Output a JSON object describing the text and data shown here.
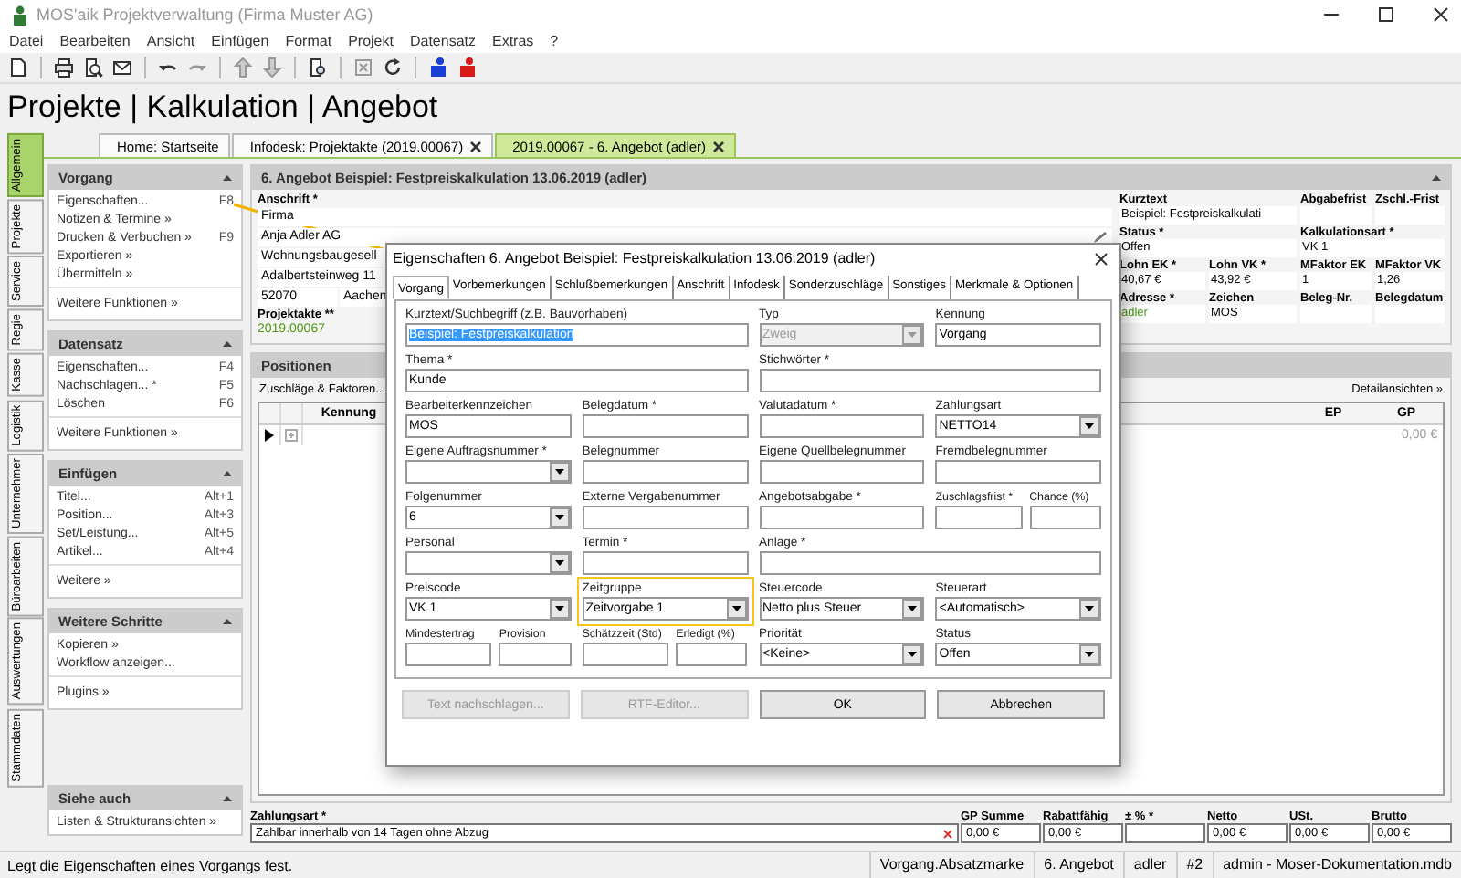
{
  "window": {
    "title": "MOS'aik Projektverwaltung (Firma Muster AG)"
  },
  "menu": [
    "Datei",
    "Bearbeiten",
    "Ansicht",
    "Einfügen",
    "Format",
    "Projekt",
    "Datensatz",
    "Extras",
    "?"
  ],
  "breadcrumb": "Projekte | Kalkulation | Angebot",
  "doc_tabs": [
    {
      "label": "Home: Startseite",
      "closable": false,
      "selected": false
    },
    {
      "label": "Infodesk: Projektakte (2019.00067)",
      "closable": true,
      "selected": false
    },
    {
      "label": "2019.00067 - 6. Angebot (adler)",
      "closable": true,
      "selected": true
    }
  ],
  "side_tabs": [
    {
      "label": "Allgemein",
      "selected": true
    },
    {
      "label": "Projekte",
      "selected": false
    },
    {
      "label": "Service",
      "selected": false
    },
    {
      "label": "Regie",
      "selected": false
    },
    {
      "label": "Kasse",
      "selected": false
    },
    {
      "label": "Logistik",
      "selected": false
    },
    {
      "label": "Unternehmer",
      "selected": false
    },
    {
      "label": "Büroarbeiten",
      "selected": false
    },
    {
      "label": "Auswertungen",
      "selected": false
    },
    {
      "label": "Stammdaten",
      "selected": false
    }
  ],
  "task_panels": [
    {
      "title": "Vorgang",
      "groups": [
        [
          {
            "label": "Eigenschaften...",
            "shortcut": "F8"
          },
          {
            "label": "Notizen & Termine »"
          },
          {
            "label": "Drucken & Verbuchen »",
            "shortcut": "F9"
          },
          {
            "label": "Exportieren »"
          },
          {
            "label": "Übermitteln »"
          }
        ],
        [
          {
            "label": "Weitere Funktionen »"
          }
        ]
      ]
    },
    {
      "title": "Datensatz",
      "groups": [
        [
          {
            "label": "Eigenschaften...",
            "shortcut": "F4"
          },
          {
            "label": "Nachschlagen... *",
            "shortcut": "F5"
          },
          {
            "label": "Löschen",
            "shortcut": "F6"
          }
        ],
        [
          {
            "label": "Weitere Funktionen »"
          }
        ]
      ]
    },
    {
      "title": "Einfügen",
      "groups": [
        [
          {
            "label": "Titel...",
            "shortcut": "Alt+1"
          },
          {
            "label": "Position...",
            "shortcut": "Alt+3"
          },
          {
            "label": "Set/Leistung...",
            "shortcut": "Alt+5"
          },
          {
            "label": "Artikel...",
            "shortcut": "Alt+4"
          }
        ],
        [
          {
            "label": "Weitere »"
          }
        ]
      ]
    },
    {
      "title": "Weitere Schritte",
      "groups": [
        [
          {
            "label": "Kopieren »"
          },
          {
            "label": "Workflow anzeigen..."
          }
        ],
        [
          {
            "label": "Plugins »"
          }
        ]
      ]
    },
    {
      "title": "Siehe auch",
      "groups": [
        [
          {
            "label": "Listen & Strukturansichten »"
          }
        ]
      ]
    }
  ],
  "document": {
    "title": "6. Angebot Beispiel: Festpreiskalkulation 13.06.2019 (adler)",
    "address": {
      "label": "Anschrift *",
      "lines": [
        "Firma",
        "Anja Adler AG",
        "Wohnungsbaugesell",
        "Adalbertsteinweg 11"
      ],
      "zip": "52070",
      "city": "Aachen"
    },
    "project": {
      "label": "Projektakte **",
      "value": "2019.00067"
    },
    "summary": [
      {
        "label": "Kurztext",
        "value": "Beispiel: Festpreiskalkulati",
        "kind": "wide"
      },
      {
        "label": "Abgabefrist",
        "kind": "narrow"
      },
      {
        "label": "Zschl.-Frist",
        "kind": "narrow"
      },
      {
        "label": "Status *",
        "value": "Offen",
        "kind": "wide"
      },
      {
        "label": "Kalkulationsart *",
        "value": "VK 1",
        "kind": "wide"
      },
      {
        "label": "Lohn EK *",
        "value": "40,67 €",
        "kind": "narrow"
      },
      {
        "label": "Lohn VK *",
        "value": "43,92 €",
        "kind": "narrow"
      },
      {
        "label": "MFaktor EK",
        "value": "1",
        "kind": "narrow"
      },
      {
        "label": "MFaktor VK",
        "value": "1,26",
        "kind": "narrow"
      },
      {
        "label": "Adresse *",
        "value": "adler",
        "kind": "narrow",
        "link": true
      },
      {
        "label": "Zeichen",
        "value": "MOS",
        "kind": "narrow"
      },
      {
        "label": "Beleg-Nr.",
        "kind": "narrow"
      },
      {
        "label": "Belegdatum",
        "kind": "narrow"
      }
    ]
  },
  "positions": {
    "title": "Positionen",
    "link": "Zuschläge & Faktoren...",
    "details_link": "Detailansichten »",
    "columns": [
      "Kennung",
      "EP",
      "GP"
    ],
    "rows": [
      {
        "gp": "0,00 €"
      }
    ]
  },
  "footer": {
    "payment_label": "Zahlungsart *",
    "payment": "Zahlbar innerhalb von 14 Tagen ohne Abzug",
    "totals": [
      {
        "label": "GP Summe",
        "value": "0,00 €"
      },
      {
        "label": "Rabattfähig",
        "value": "0,00 €"
      },
      {
        "label": "± % *"
      },
      {
        "label": "Netto",
        "value": "0,00 €"
      },
      {
        "label": "USt.",
        "value": "0,00 €"
      },
      {
        "label": "Brutto",
        "value": "0,00 €"
      }
    ]
  },
  "dialog": {
    "title": "Eigenschaften 6. Angebot Beispiel: Festpreiskalkulation 13.06.2019 (adler)",
    "tabs": [
      {
        "label": "Vorgang",
        "selected": true
      },
      {
        "label": "Vorbemerkungen",
        "selected": false
      },
      {
        "label": "Schlußbemerkungen",
        "selected": false
      },
      {
        "label": "Anschrift",
        "selected": false
      },
      {
        "label": "Infodesk",
        "selected": false
      },
      {
        "label": "Sonderzuschläge",
        "selected": false
      },
      {
        "label": "Sonstiges",
        "selected": false
      },
      {
        "label": "Merkmale & Optionen",
        "selected": false
      }
    ],
    "fields": [
      {
        "label": "Kurztext/Suchbegriff (z.B. Bauvorhaben)",
        "kind": "long-text",
        "value": "Beispiel: Festpreiskalkulation",
        "value_selected": true
      },
      {
        "label": "Typ",
        "kind": "dropdown",
        "value": "Zweig",
        "disabled": true
      },
      {
        "label": "Kennung",
        "kind": "text",
        "value": "Vorgang"
      },
      {
        "label": "Thema *",
        "kind": "long-text",
        "value": "Kunde"
      },
      {
        "label": "Stichwörter *",
        "kind": "long-text"
      },
      {
        "label": "Bearbeiterkennzeichen",
        "kind": "text",
        "value": "MOS"
      },
      {
        "label": "Belegdatum *",
        "kind": "text"
      },
      {
        "label": "Valutadatum *",
        "kind": "text"
      },
      {
        "label": "Zahlungsart",
        "kind": "dropdown",
        "value": "NETTO14"
      },
      {
        "label": "Eigene Auftragsnummer *",
        "kind": "dropdown"
      },
      {
        "label": "Belegnummer",
        "kind": "text"
      },
      {
        "label": "Eigene Quellbelegnummer",
        "kind": "text"
      },
      {
        "label": "Fremdbelegnummer",
        "kind": "text"
      },
      {
        "label": "Folgenummer",
        "kind": "dropdown",
        "value": "6"
      },
      {
        "label": "Externe Vergabenummer",
        "kind": "text"
      },
      {
        "label": "Angebotsabgabe *",
        "kind": "text"
      },
      {
        "kind": "pair",
        "fields": [
          {
            "label": "Zuschlagsfrist *",
            "kind": "text"
          },
          {
            "label": "Chance (%)",
            "kind": "text"
          }
        ]
      },
      {
        "label": "Personal",
        "kind": "dropdown"
      },
      {
        "label": "Termin *",
        "kind": "text"
      },
      {
        "label": "Anlage *",
        "kind": "long-text"
      },
      {
        "label": "Preiscode",
        "kind": "dropdown",
        "value": "VK 1"
      },
      {
        "label": "Zeitgruppe",
        "kind": "dropdown",
        "value": "Zeitvorgabe 1",
        "highlighted": true
      },
      {
        "label": "Steuercode",
        "kind": "dropdown",
        "value": "Netto plus Steuer"
      },
      {
        "label": "Steuerart",
        "kind": "dropdown",
        "value": "<Automatisch>"
      },
      {
        "kind": "pair",
        "fields": [
          {
            "label": "Mindestertrag",
            "kind": "text"
          },
          {
            "label": "Provision",
            "kind": "text"
          }
        ]
      },
      {
        "kind": "pair",
        "fields": [
          {
            "label": "Schätzzeit (Std)",
            "kind": "text"
          },
          {
            "label": "Erledigt (%)",
            "kind": "text"
          }
        ]
      },
      {
        "label": "Priorität",
        "kind": "dropdown",
        "value": "<Keine>"
      },
      {
        "label": "Status",
        "kind": "dropdown",
        "value": "Offen"
      }
    ],
    "buttons": [
      {
        "label": "Text nachschlagen...",
        "disabled": true
      },
      {
        "label": "RTF-Editor...",
        "disabled": true
      },
      {
        "label": "OK",
        "disabled": false
      },
      {
        "label": "Abbrechen",
        "disabled": false
      }
    ]
  },
  "status_bar": {
    "message": "Legt die Eigenschaften eines Vorgangs fest.",
    "panes": [
      "Vorgang.Absatzmarke",
      "6. Angebot",
      "adler",
      "#2",
      "admin - Moser-Dokumentation.mdb"
    ]
  }
}
